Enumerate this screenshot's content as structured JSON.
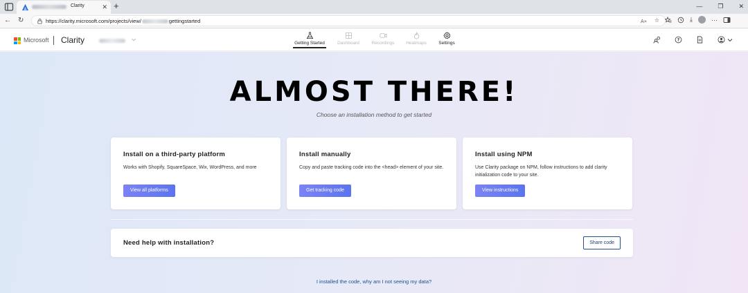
{
  "browser": {
    "tab_title": "Clarity",
    "tab_close": "✕",
    "new_tab": "+",
    "url_prefix": "https://clarity.microsoft.com/projects/view/",
    "url_suffix": "gettingstarted",
    "nav_back": "←",
    "nav_reload": "↻",
    "window_controls": [
      "—",
      "❐",
      "✕"
    ],
    "toolbar_glyphs": [
      "☆",
      "⤓",
      "···"
    ]
  },
  "header": {
    "ms_name": "Microsoft",
    "app_name": "Clarity",
    "project_chevron": "⌵",
    "tabs": [
      {
        "label": "Getting Started",
        "icon": "flask-icon",
        "state": "active"
      },
      {
        "label": "Dashboard",
        "icon": "dashboard-icon",
        "state": "disabled"
      },
      {
        "label": "Recordings",
        "icon": "video-icon",
        "state": "disabled"
      },
      {
        "label": "Heatmaps",
        "icon": "flame-icon",
        "state": "disabled"
      },
      {
        "label": "Settings",
        "icon": "gear-icon",
        "state": "normal"
      }
    ],
    "right_icons": [
      "people-icon",
      "help-icon",
      "document-icon",
      "account-icon"
    ]
  },
  "colors": {
    "ms_red": "#f25022",
    "ms_green": "#7fba00",
    "ms_blue": "#00a4ef",
    "ms_yellow": "#ffb900",
    "primary_button": "#5b74ee",
    "link": "#1f4f8f"
  },
  "hero": {
    "title": "ALMOST THERE!",
    "subtitle": "Choose an installation method to get started"
  },
  "cards": [
    {
      "title": "Install on a third-party platform",
      "description": "Works with Shopify, SquareSpace, Wix, WordPress, and more",
      "button": "View all platforms"
    },
    {
      "title": "Install manually",
      "description": "Copy and paste tracking code into the <head> element of your site.",
      "button": "Get tracking code"
    },
    {
      "title": "Install using NPM",
      "description": "Use Clarity package on NPM, follow instructions to add clarity initialization code to your site.",
      "button": "View instructions"
    }
  ],
  "help": {
    "title": "Need help with installation?",
    "button": "Share code",
    "link": "I installed the code, why am I not seeing my data?"
  }
}
